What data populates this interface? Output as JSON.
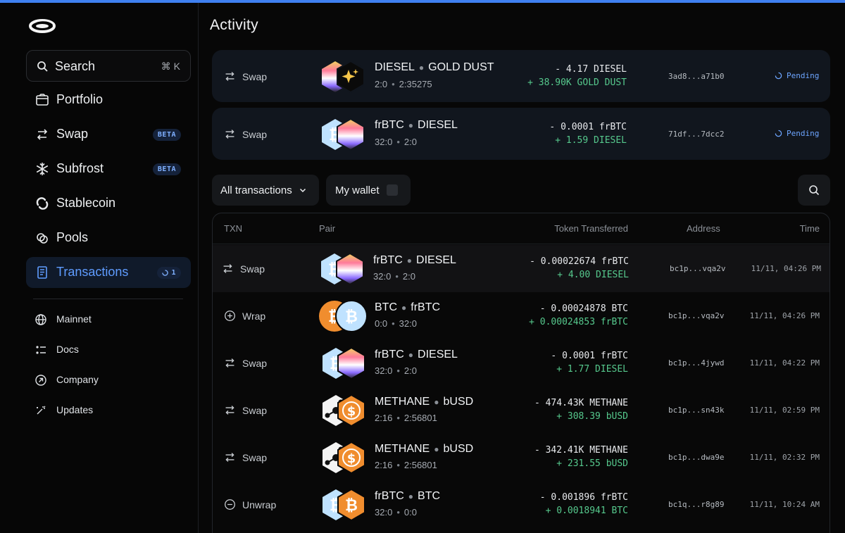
{
  "sidebar": {
    "search": {
      "label": "Search",
      "shortcut": "⌘ K"
    },
    "nav": [
      {
        "label": "Portfolio",
        "icon": "portfolio-icon"
      },
      {
        "label": "Swap",
        "icon": "swap-icon",
        "badge": "BETA"
      },
      {
        "label": "Subfrost",
        "icon": "snowflake-icon",
        "badge": "BETA"
      },
      {
        "label": "Stablecoin",
        "icon": "stablecoin-icon"
      },
      {
        "label": "Pools",
        "icon": "pools-icon"
      },
      {
        "label": "Transactions",
        "icon": "transactions-icon",
        "badge": "1",
        "active": true
      }
    ],
    "secondary": [
      {
        "label": "Mainnet",
        "icon": "globe-icon"
      },
      {
        "label": "Docs",
        "icon": "docs-icon"
      },
      {
        "label": "Company",
        "icon": "company-icon"
      },
      {
        "label": "Updates",
        "icon": "updates-icon"
      }
    ]
  },
  "main": {
    "title": "Activity",
    "pending": [
      {
        "type": "Swap",
        "pair": [
          "DIESEL",
          "GOLD DUST"
        ],
        "ids": [
          "2:0",
          "2:35275"
        ],
        "out": "- 4.17 DIESEL",
        "in": "+ 38.90K GOLD DUST",
        "address": "3ad8...a71b0",
        "status": "Pending"
      },
      {
        "type": "Swap",
        "pair": [
          "frBTC",
          "DIESEL"
        ],
        "ids": [
          "32:0",
          "2:0"
        ],
        "out": "- 0.0001 frBTC",
        "in": "+ 1.59 DIESEL",
        "address": "71df...7dcc2",
        "status": "Pending"
      }
    ],
    "filters": {
      "all_label": "All transactions",
      "wallet_label": "My wallet"
    },
    "table": {
      "headers": {
        "txn": "TXN",
        "pair": "Pair",
        "token": "Token Transferred",
        "address": "Address",
        "time": "Time"
      },
      "rows": [
        {
          "type": "Swap",
          "pair": [
            "frBTC",
            "DIESEL"
          ],
          "ids": [
            "32:0",
            "2:0"
          ],
          "out": "- 0.00022674 frBTC",
          "in": "+ 4.00 DIESEL",
          "address": "bc1p...vqa2v",
          "time": "11/11, 04:26 PM"
        },
        {
          "type": "Wrap",
          "pair": [
            "BTC",
            "frBTC"
          ],
          "ids": [
            "0:0",
            "32:0"
          ],
          "out": "- 0.00024878 BTC",
          "in": "+ 0.00024853 frBTC",
          "address": "bc1p...vqa2v",
          "time": "11/11, 04:26 PM"
        },
        {
          "type": "Swap",
          "pair": [
            "frBTC",
            "DIESEL"
          ],
          "ids": [
            "32:0",
            "2:0"
          ],
          "out": "- 0.0001 frBTC",
          "in": "+ 1.77 DIESEL",
          "address": "bc1p...4jywd",
          "time": "11/11, 04:22 PM"
        },
        {
          "type": "Swap",
          "pair": [
            "METHANE",
            "bUSD"
          ],
          "ids": [
            "2:16",
            "2:56801"
          ],
          "out": "- 474.43K METHANE",
          "in": "+ 308.39 bUSD",
          "address": "bc1p...sn43k",
          "time": "11/11, 02:59 PM"
        },
        {
          "type": "Swap",
          "pair": [
            "METHANE",
            "bUSD"
          ],
          "ids": [
            "2:16",
            "2:56801"
          ],
          "out": "- 342.41K METHANE",
          "in": "+ 231.55 bUSD",
          "address": "bc1p...dwa9e",
          "time": "11/11, 02:32 PM"
        },
        {
          "type": "Unwrap",
          "pair": [
            "frBTC",
            "BTC"
          ],
          "ids": [
            "32:0",
            "0:0"
          ],
          "out": "- 0.001896 frBTC",
          "in": "+ 0.0018941 BTC",
          "address": "bc1q...r8g89",
          "time": "11/11, 10:24 AM"
        }
      ]
    }
  },
  "colors": {
    "accent": "#3f80f0",
    "positive": "#56c98d",
    "pending": "#6da5ff",
    "active_bg": "#101a2a"
  }
}
